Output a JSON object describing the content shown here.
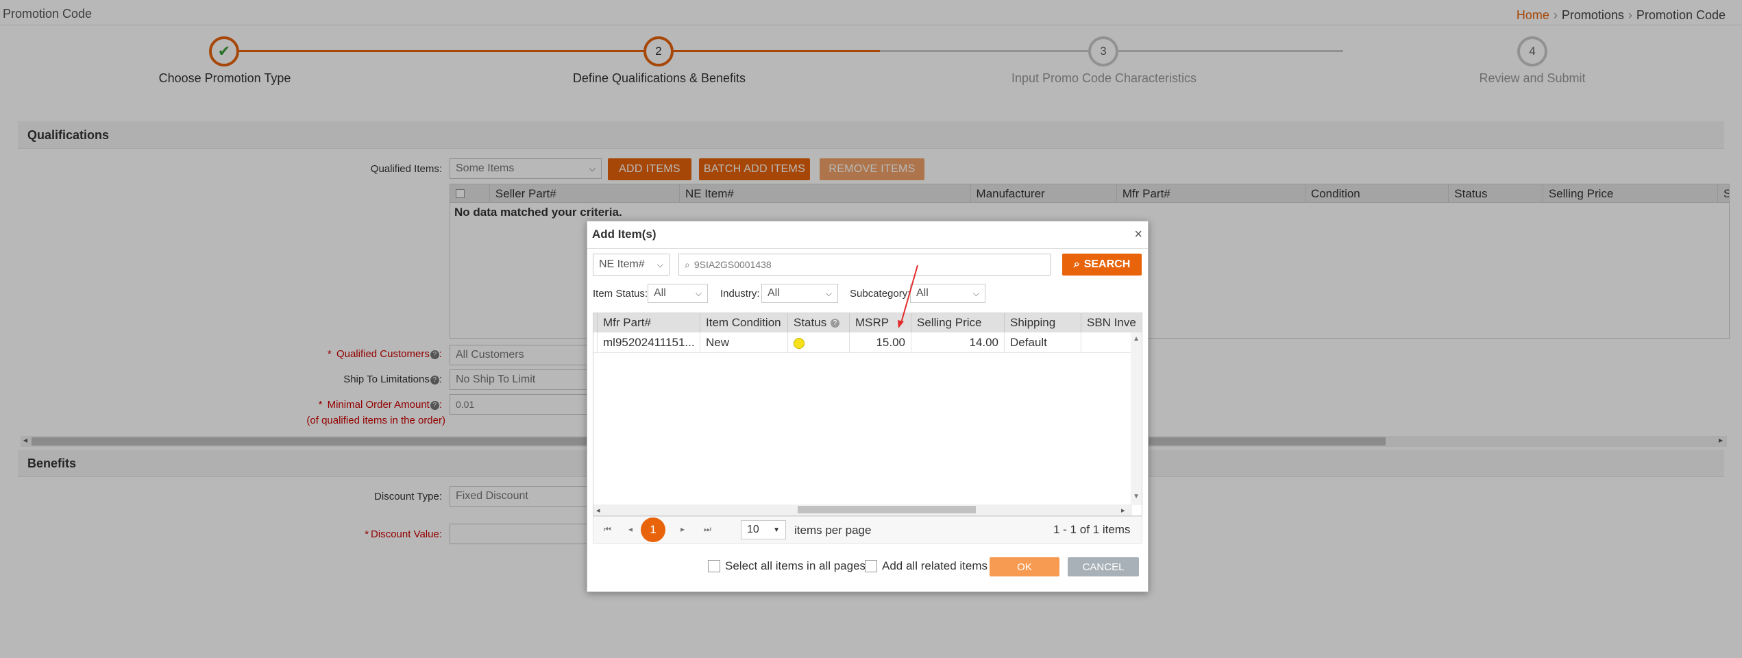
{
  "page": {
    "title": "Promotion Code",
    "breadcrumb": [
      "Home",
      "Promotions",
      "Promotion Code"
    ]
  },
  "stepper": {
    "steps": [
      {
        "num": "",
        "label": "Choose Promotion Type",
        "state": "done"
      },
      {
        "num": "2",
        "label": "Define Qualifications & Benefits",
        "state": "active"
      },
      {
        "num": "3",
        "label": "Input Promo Code Characteristics",
        "state": "inactive"
      },
      {
        "num": "4",
        "label": "Review and Submit",
        "state": "inactive"
      }
    ],
    "check_glyph": "✔"
  },
  "qualifications": {
    "heading": "Qualifications",
    "qualified_items_label": "Qualified Items:",
    "qualified_items_value": "Some Items",
    "buttons": {
      "add": "ADD ITEMS",
      "batch_add": "BATCH ADD ITEMS",
      "remove": "REMOVE ITEMS"
    },
    "grid_columns": [
      "Seller Part#",
      "NE Item#",
      "Manufacturer",
      "Mfr Part#",
      "Condition",
      "Status",
      "Selling Price",
      "S"
    ],
    "empty_message": "No data matched your criteria.",
    "qualified_customers_label": "Qualified Customers",
    "qualified_customers_value": "All Customers",
    "ship_to_label": "Ship To Limitations",
    "ship_to_value": "No Ship To Limit",
    "min_order_label": "Minimal Order Amount",
    "min_order_sub": "(of qualified items in the order)",
    "min_order_value": "0.01"
  },
  "benefits": {
    "heading": "Benefits",
    "discount_type_label": "Discount Type:",
    "discount_type_value": "Fixed Discount",
    "discount_value_label": "Discount Value:",
    "discount_value_value": ""
  },
  "modal": {
    "title": "Add Item(s)",
    "close": "×",
    "search_by": "NE Item#",
    "search_value": "9SIA2GS0001438",
    "search_button": "SEARCH",
    "filters": {
      "item_status_label": "Item Status:",
      "item_status_value": "All",
      "industry_label": "Industry:",
      "industry_value": "All",
      "subcategory_label": "Subcategory:",
      "subcategory_value": "All"
    },
    "columns": [
      "Mfr Part#",
      "Item Condition",
      "Status",
      "MSRP",
      "Selling Price",
      "Shipping",
      "SBN Inve"
    ],
    "rows": [
      {
        "mfr_part": "ml95202411151...",
        "condition": "New",
        "status": "yellow",
        "msrp": "15.00",
        "selling_price": "14.00",
        "shipping": "Default",
        "sbn": ""
      }
    ],
    "pager": {
      "current_page": "1",
      "page_size": "10",
      "items_per_page_label": "items per page",
      "summary": "1 - 1 of 1 items"
    },
    "select_all_label": "Select all items in all pages",
    "add_related_label": "Add all related items",
    "ok": "OK",
    "cancel": "CANCEL"
  },
  "colors": {
    "accent": "#e8630a",
    "status_yellow": "#f5e21a",
    "required": "#cc0000"
  }
}
